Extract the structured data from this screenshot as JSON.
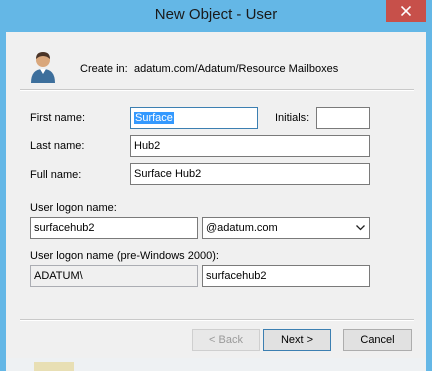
{
  "window": {
    "title": "New Object - User",
    "close_glyph": "✕"
  },
  "header": {
    "create_in_label": "Create in:",
    "create_in_path": "adatum.com/Adatum/Resource Mailboxes",
    "icon": "user-avatar-icon"
  },
  "form": {
    "first_name_label": "First name:",
    "first_name_value": "Surface",
    "initials_label": "Initials:",
    "initials_value": "",
    "last_name_label": "Last name:",
    "last_name_value": "Hub2",
    "full_name_label": "Full name:",
    "full_name_value": "Surface Hub2",
    "logon_label": "User logon name:",
    "logon_value": "surfacehub2",
    "domain_value": "@adatum.com",
    "logon_pre2000_label": "User logon name (pre-Windows 2000):",
    "domain_prefix_value": "ADATUM\\",
    "logon_pre2000_value": "surfacehub2"
  },
  "buttons": {
    "back_label": "< Back",
    "next_label": "Next >",
    "cancel_label": "Cancel"
  },
  "colors": {
    "title_bar": "#64b7e6",
    "close_button": "#c7504a",
    "dialog_body": "#f0f0f0",
    "selection": "#3399ff"
  }
}
